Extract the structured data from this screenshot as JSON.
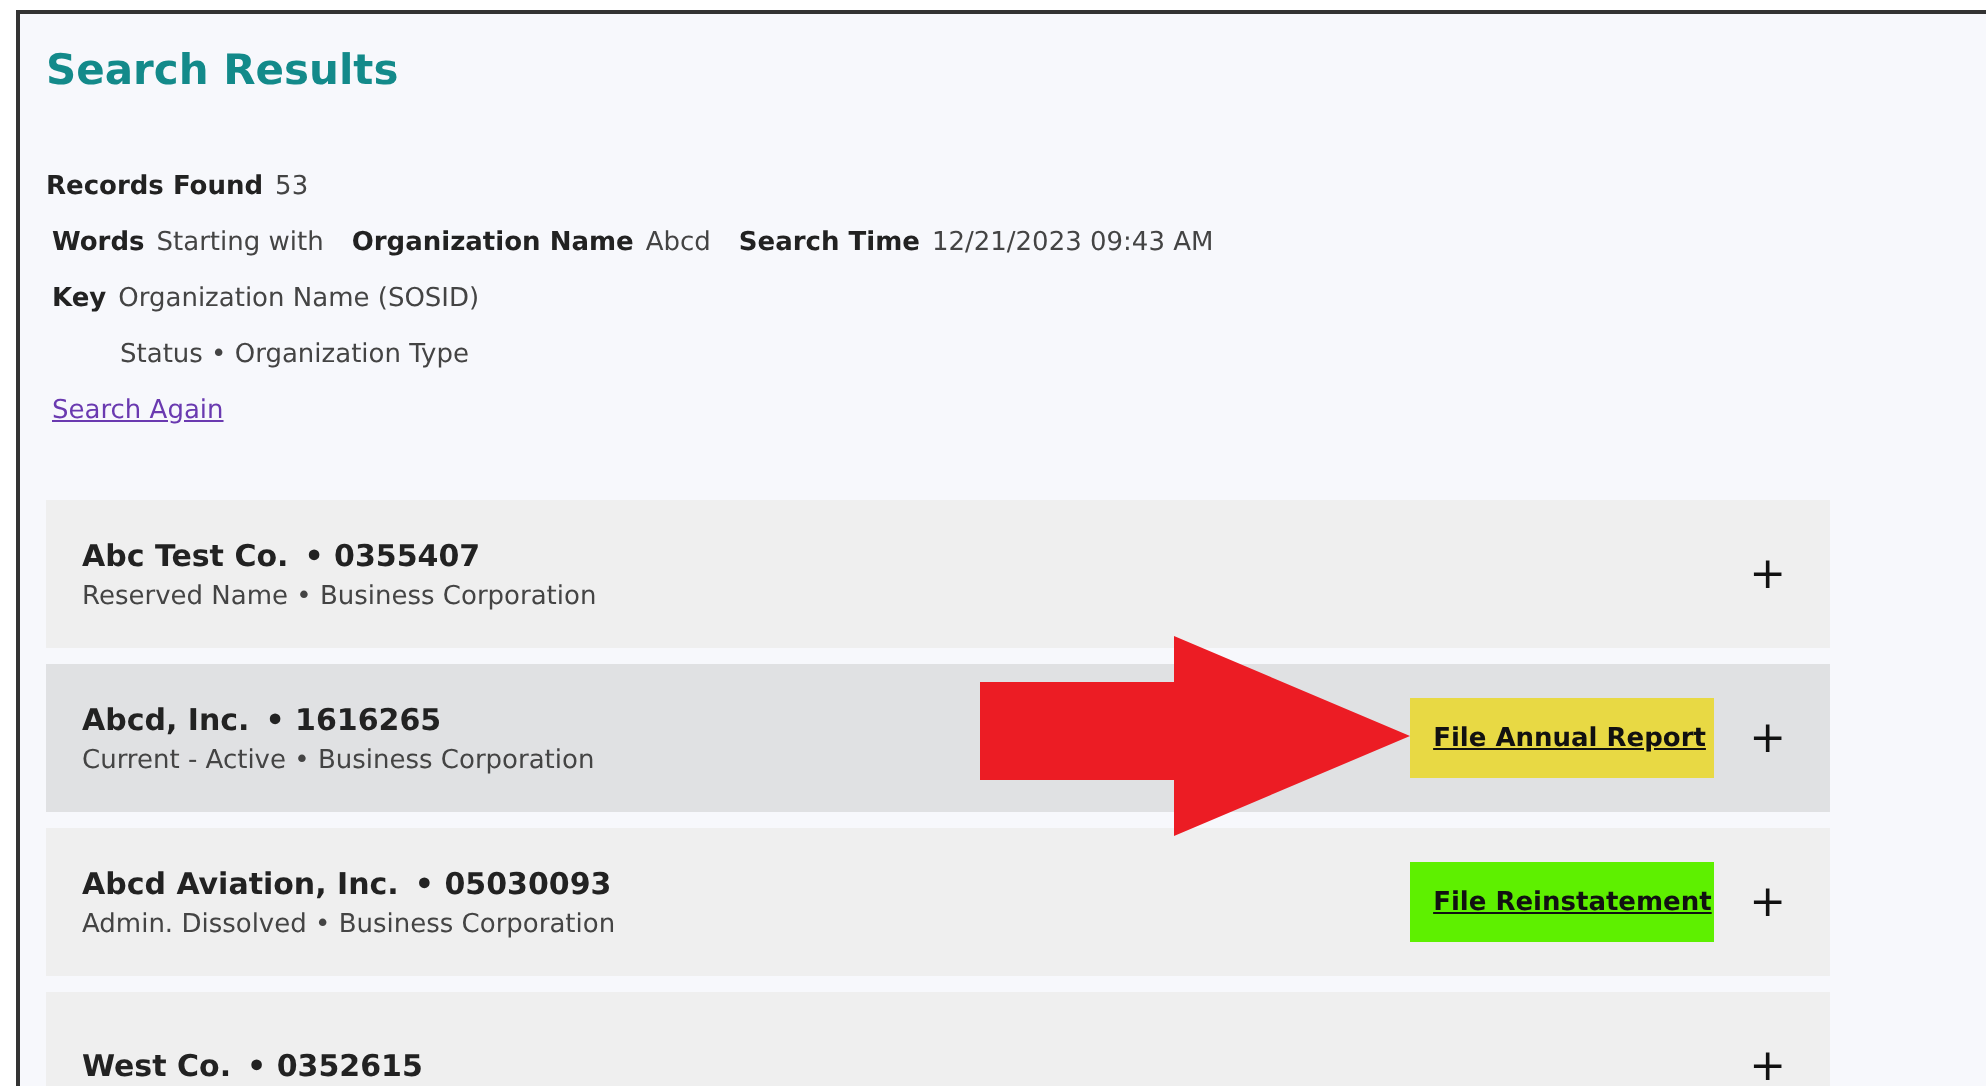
{
  "title": "Search Results",
  "summary": {
    "records_label": "Records Found",
    "records_value": "53",
    "criteria": [
      {
        "label": "Words",
        "value": "Starting with"
      },
      {
        "label": "Organization Name",
        "value": "Abcd"
      },
      {
        "label": "Search Time",
        "value": "12/21/2023 09:43 AM"
      }
    ],
    "key_label": "Key",
    "key_lines": [
      "Organization Name (SOSID)",
      "Status • Organization Type"
    ],
    "search_again": "Search Again"
  },
  "results": [
    {
      "name": "Abc Test Co.",
      "sosid": "• 0355407",
      "status": "Reserved Name",
      "type": "Business Corporation",
      "selected": false,
      "expand": "+"
    },
    {
      "name": "Abcd, Inc.",
      "sosid": "• 1616265",
      "status": "Current - Active",
      "type": "Business Corporation",
      "selected": true,
      "arrow": true,
      "expand": "+",
      "action": {
        "label": "File Annual Report",
        "color": "#e8d944"
      }
    },
    {
      "name": "Abcd Aviation, Inc.",
      "sosid": "• 05030093",
      "status": "Admin. Dissolved",
      "type": "Business Corporation",
      "selected": false,
      "expand": "+",
      "action": {
        "label": "File Reinstatement",
        "color": "#5ef000"
      }
    },
    {
      "name": "West Co.",
      "sosid": "• 0352615",
      "selected": false,
      "expand": "+"
    }
  ],
  "separator": "•"
}
